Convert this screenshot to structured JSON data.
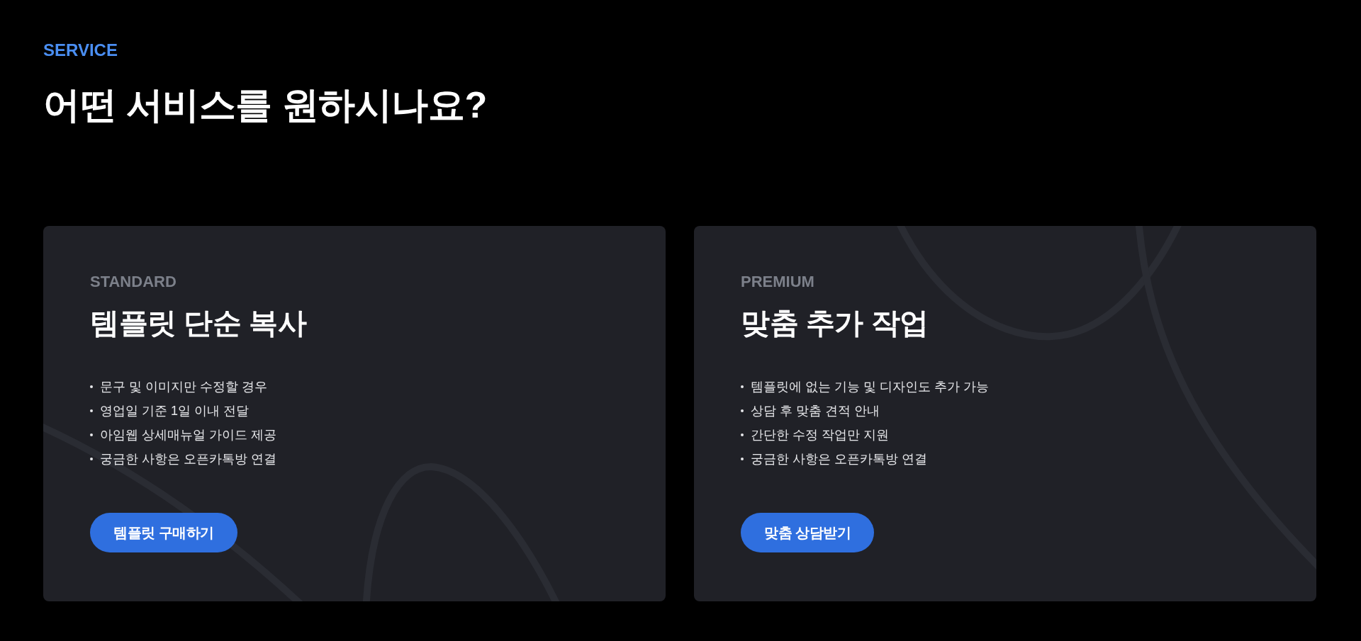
{
  "header": {
    "eyebrow": "SERVICE",
    "title": "어떤 서비스를 원하시나요?"
  },
  "plans": [
    {
      "tier": "STANDARD",
      "title": "템플릿 단순 복사",
      "features": [
        "문구 및 이미지만 수정할 경우",
        "영업일 기준 1일 이내 전달",
        "아임웹 상세매뉴얼 가이드 제공",
        "궁금한 사항은 오픈카톡방 연결"
      ],
      "button": "템플릿 구매하기"
    },
    {
      "tier": "PREMIUM",
      "title": "맞춤 추가 작업",
      "features": [
        "템플릿에 없는 기능 및 디자인도 추가 가능",
        "상담 후 맞춤 견적 안내",
        "간단한 수정 작업만 지원",
        "궁금한 사항은 오픈카톡방 연결"
      ],
      "button": "맞춤 상담받기"
    }
  ]
}
